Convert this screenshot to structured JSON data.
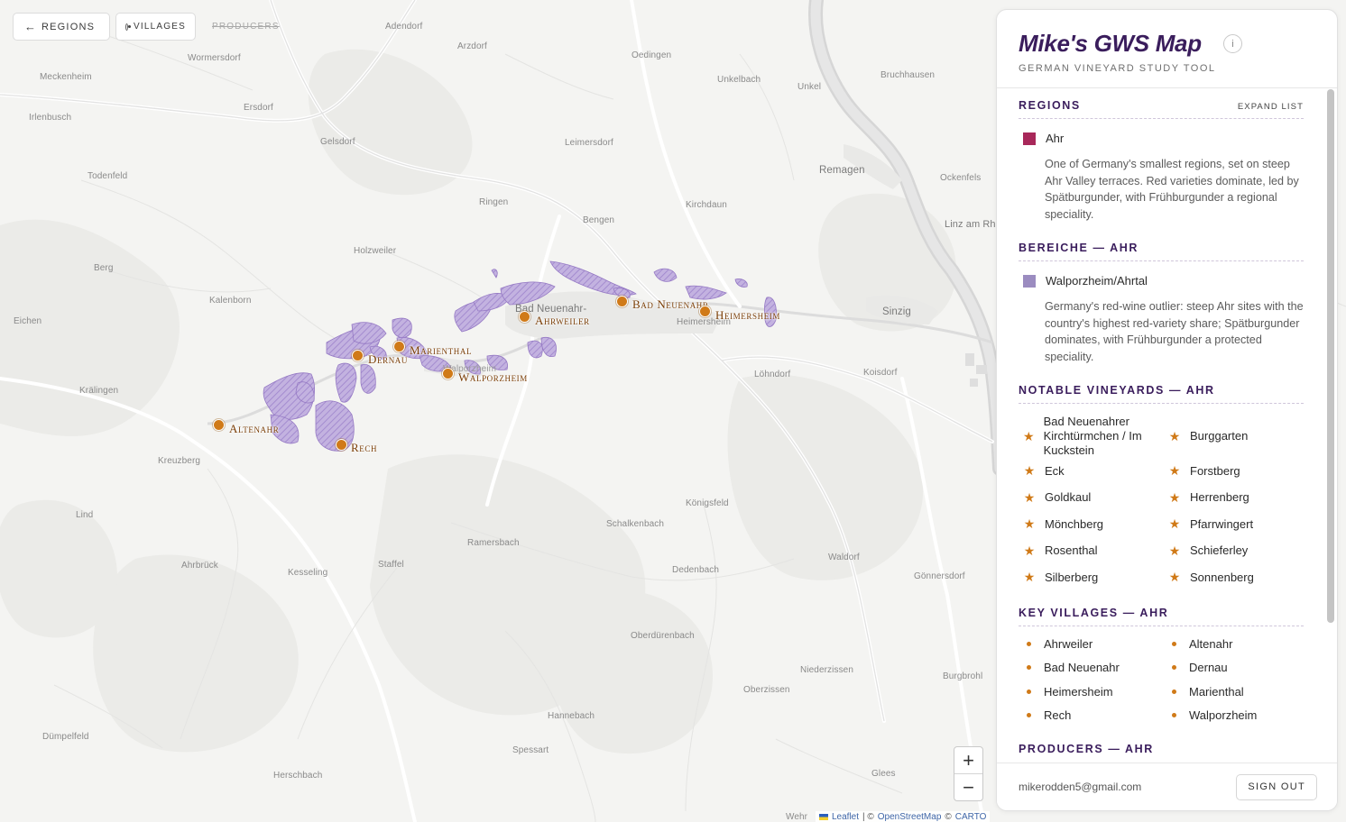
{
  "controls": {
    "regions_label": "Regions",
    "villages_label": "Villages",
    "producers_label": "Producers"
  },
  "map": {
    "place_labels": [
      "Adendorf",
      "Arzdorf",
      "Oedingen",
      "Unkelbach",
      "Unkel",
      "Bruchhausen",
      "Wormersdorf",
      "Meckenheim",
      "Ersdorf",
      "Irlenbusch",
      "Gelsdorf",
      "Leimersdorf",
      "Remagen",
      "Ockenfels",
      "Todenfeld",
      "Ringen",
      "Kirchdaun",
      "Bengen",
      "Linz am Rhein",
      "Holzweiler",
      "Berg",
      "Kalenborn",
      "Sinzig",
      "Eichen",
      "Krälingen",
      "Löhndorf",
      "Koisdorf",
      "Kreuzberg",
      "Lind",
      "Königsfeld",
      "Schalkenbach",
      "Ramersbach",
      "Waldorf",
      "Ahrbrück",
      "Kesseling",
      "Staffel",
      "Dedenbach",
      "Gönnersdorf",
      "Oberdürenbach",
      "Niederzissen",
      "Burgbrohl",
      "Oberzissen",
      "Hannebach",
      "Spessart",
      "Dümpelfeld",
      "Herschbach",
      "Glees",
      "Wehr",
      "Bad Neuenahr-",
      "Heimersheim",
      "Walporzheim"
    ],
    "villages": [
      "Altenahr",
      "Rech",
      "Dernau",
      "Marienthal",
      "Walporzheim",
      "Ahrweiler",
      "Bad Neuenahr",
      "Heimersheim"
    ],
    "zoom_in": "+",
    "zoom_out": "−",
    "attribution": {
      "leaflet": "Leaflet",
      "sep1": "| ©",
      "osm": "OpenStreetMap",
      "sep2": "©",
      "carto": "CARTO"
    }
  },
  "panel": {
    "title": "Mike's GWS Map",
    "info_icon": "i",
    "subtitle": "German Vineyard Study Tool",
    "regions": {
      "heading": "Regions",
      "action": "EXPAND LIST",
      "item_label": "Ahr",
      "item_color": "#a8285a",
      "description": "One of Germany's smallest regions, set on steep Ahr Valley terraces. Red varieties dominate, led by Spätburgunder, with Frühburgunder a regional speciality."
    },
    "bereiche": {
      "heading": "Bereiche — Ahr",
      "item_label": "Walporzheim/Ahrtal",
      "item_color": "#9b8cc0",
      "description": "Germany's red-wine outlier: steep Ahr sites with the country's highest red-variety share; Spätburgunder dominates, with Frühburgunder a protected speciality."
    },
    "vineyards": {
      "heading": "Notable Vineyards — Ahr",
      "items": [
        "Bad Neuenahrer Kirchtürmchen / Im Kuckstein",
        "Burggarten",
        "Eck",
        "Forstberg",
        "Goldkaul",
        "Herrenberg",
        "Mönchberg",
        "Pfarrwingert",
        "Rosenthal",
        "Schieferley",
        "Silberberg",
        "Sonnenberg"
      ]
    },
    "key_villages": {
      "heading": "Key Villages — Ahr",
      "items": [
        "Ahrweiler",
        "Altenahr",
        "Bad Neuenahr",
        "Dernau",
        "Heimersheim",
        "Marienthal",
        "Rech",
        "Walporzheim"
      ]
    },
    "producers": {
      "heading": "Producers — Ahr"
    },
    "footer": {
      "email": "mikerodden5@gmail.com",
      "signout": "SIGN OUT"
    }
  }
}
